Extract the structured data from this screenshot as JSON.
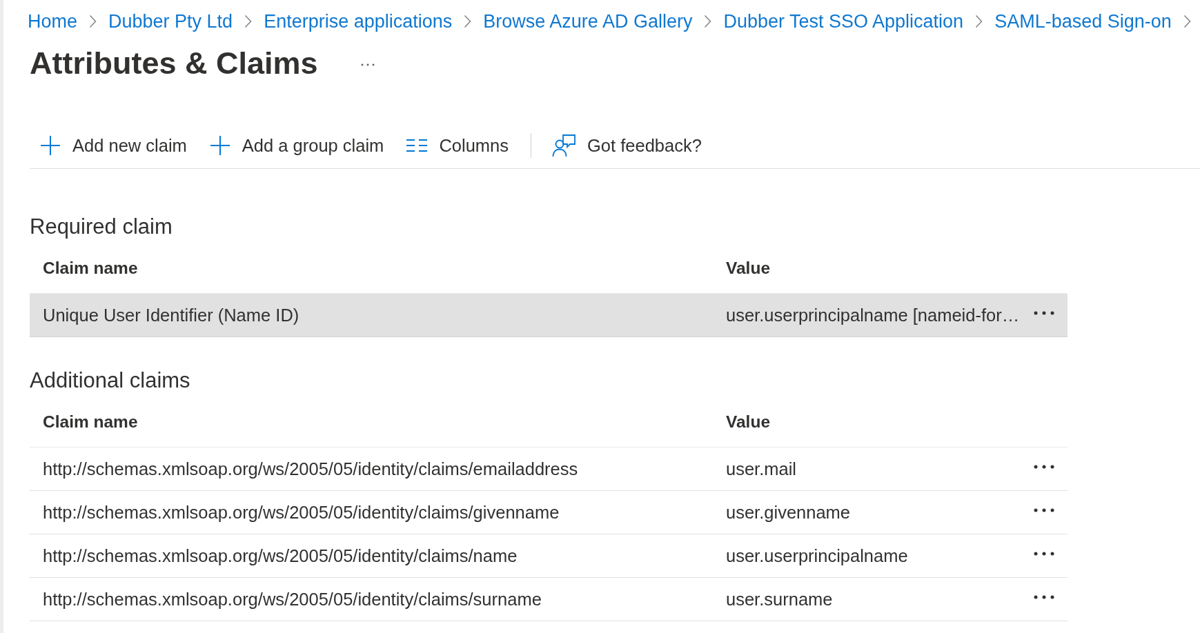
{
  "breadcrumb": [
    "Home",
    "Dubber Pty Ltd",
    "Enterprise applications",
    "Browse Azure AD Gallery",
    "Dubber Test SSO Application",
    "SAML-based Sign-on"
  ],
  "page": {
    "title": "Attributes & Claims"
  },
  "toolbar": [
    {
      "kind": "add",
      "label": "Add new claim"
    },
    {
      "kind": "add",
      "label": "Add a group claim"
    },
    {
      "kind": "columns",
      "label": "Columns"
    },
    {
      "kind": "divider"
    },
    {
      "kind": "feedback",
      "label": "Got feedback?"
    }
  ],
  "sections": [
    {
      "heading": "Required claim",
      "columns": [
        "Claim name",
        "Value"
      ],
      "rows": [
        {
          "claim_name": "Unique User Identifier (Name ID)",
          "value": "user.userprincipalname [nameid-for…",
          "highlighted": true
        }
      ]
    },
    {
      "heading": "Additional claims",
      "columns": [
        "Claim name",
        "Value"
      ],
      "rows": [
        {
          "claim_name": "http://schemas.xmlsoap.org/ws/2005/05/identity/claims/emailaddress",
          "value": "user.mail",
          "highlighted": false
        },
        {
          "claim_name": "http://schemas.xmlsoap.org/ws/2005/05/identity/claims/givenname",
          "value": "user.givenname",
          "highlighted": false
        },
        {
          "claim_name": "http://schemas.xmlsoap.org/ws/2005/05/identity/claims/name",
          "value": "user.userprincipalname",
          "highlighted": false
        },
        {
          "claim_name": "http://schemas.xmlsoap.org/ws/2005/05/identity/claims/surname",
          "value": "user.surname",
          "highlighted": false
        }
      ]
    }
  ]
}
